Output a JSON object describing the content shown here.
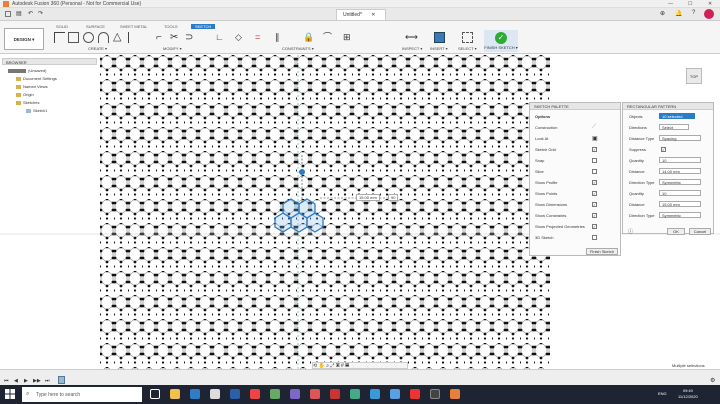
{
  "window": {
    "title": "Autodesk Fusion 360 (Personal - Not for Commercial Use)",
    "minimize": "—",
    "maximize": "☐",
    "close": "✕"
  },
  "document_tab": {
    "label": "Untitled*",
    "close": "✕"
  },
  "workspace_tabs": [
    "SOLID",
    "SURFACE",
    "SHEET METAL",
    "TOOLS",
    "SKETCH"
  ],
  "workspace_active": "SKETCH",
  "design_button": "DESIGN ▾",
  "toolbar_groups": [
    "CREATE ▾",
    "MODIFY ▾",
    "CONSTRAINTS ▾",
    "INSPECT ▾",
    "INSERT ▾",
    "SELECT ▾"
  ],
  "finish_sketch": {
    "label": "FINISH SKETCH ▾",
    "icon": "check-icon"
  },
  "browser": {
    "header": "BROWSER",
    "root": "(Unsaved)",
    "items": [
      "Document Settings",
      "Named Views",
      "Origin",
      "Sketches",
      "Sketch1"
    ]
  },
  "viewcube": "TOP",
  "canvas": {
    "dimension_label": "15.00 mm",
    "angle_label": "90"
  },
  "sketch_palette": {
    "header": "SKETCH PALETTE",
    "options_label": "Options",
    "rows": [
      {
        "label": "Construction",
        "control": "icon"
      },
      {
        "label": "Look At",
        "control": "icon"
      },
      {
        "label": "Sketch Grid",
        "checked": true
      },
      {
        "label": "Snap",
        "checked": false
      },
      {
        "label": "Slice",
        "checked": false
      },
      {
        "label": "Show Profile",
        "checked": true
      },
      {
        "label": "Show Points",
        "checked": true
      },
      {
        "label": "Show Dimensions",
        "checked": true
      },
      {
        "label": "Show Constraints",
        "checked": true
      },
      {
        "label": "Show Projected Geometries",
        "checked": true
      },
      {
        "label": "3D Sketch",
        "checked": false
      }
    ],
    "finish_button": "Finish Sketch"
  },
  "rect_pattern": {
    "header": "RECTANGULAR PATTERN",
    "rows": [
      {
        "label": "Objects",
        "value": "10 selected",
        "selected": true
      },
      {
        "label": "Directions",
        "value": "Select"
      },
      {
        "label": "Distance Type",
        "value": "Spacing"
      },
      {
        "label": "Suppress",
        "value": "☑"
      },
      {
        "label": "Quantity",
        "value": "10"
      },
      {
        "label": "Distance",
        "value": "14.00 mm"
      },
      {
        "label": "Direction Type",
        "value": "Symmetric"
      },
      {
        "label": "Quantity",
        "value": "10"
      },
      {
        "label": "Distance",
        "value": "15.00 mm"
      },
      {
        "label": "Direction Type",
        "value": "Symmetric"
      }
    ],
    "ok": "OK",
    "cancel": "Cancel"
  },
  "status": "Multiple selections",
  "timeline": {
    "buttons": [
      "⏮",
      "◀",
      "▶",
      "▶▶",
      "⏭"
    ]
  },
  "taskbar": {
    "search_placeholder": "Type here to search",
    "lang": "ENG",
    "time": "09:40",
    "date": "11/12/2020"
  },
  "colors": {
    "accent": "#2a7cc7",
    "finish_green": "#2eaa35",
    "taskbar": "#1e2432"
  }
}
